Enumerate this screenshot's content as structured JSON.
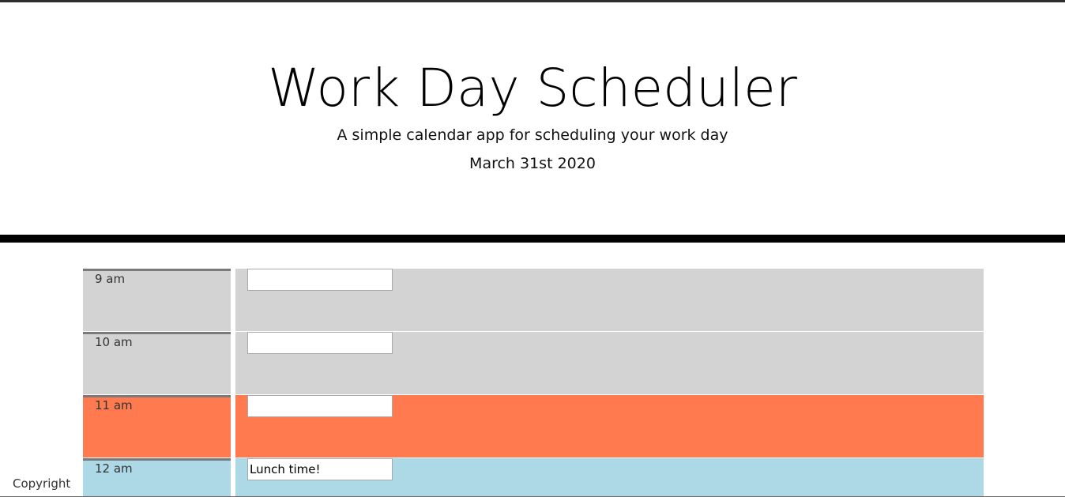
{
  "header": {
    "title": "Work Day Scheduler",
    "lead": "A simple calendar app for scheduling your work day",
    "current_date": "March 31st 2020"
  },
  "colors": {
    "past": "#d3d3d3",
    "present": "#ff7b4f",
    "future": "#add8e6"
  },
  "schedule": {
    "rows": [
      {
        "hour": "9 am",
        "state": "past",
        "task": "",
        "save_icon": "floppy-disk-icon"
      },
      {
        "hour": "10 am",
        "state": "past",
        "task": "",
        "save_icon": "floppy-disk-icon"
      },
      {
        "hour": "11 am",
        "state": "present",
        "task": "",
        "save_icon": "floppy-disk-icon"
      },
      {
        "hour": "12 am",
        "state": "future",
        "task": "Lunch time!",
        "save_icon": "floppy-disk-icon"
      }
    ]
  },
  "footer": {
    "text": "Copyright"
  }
}
